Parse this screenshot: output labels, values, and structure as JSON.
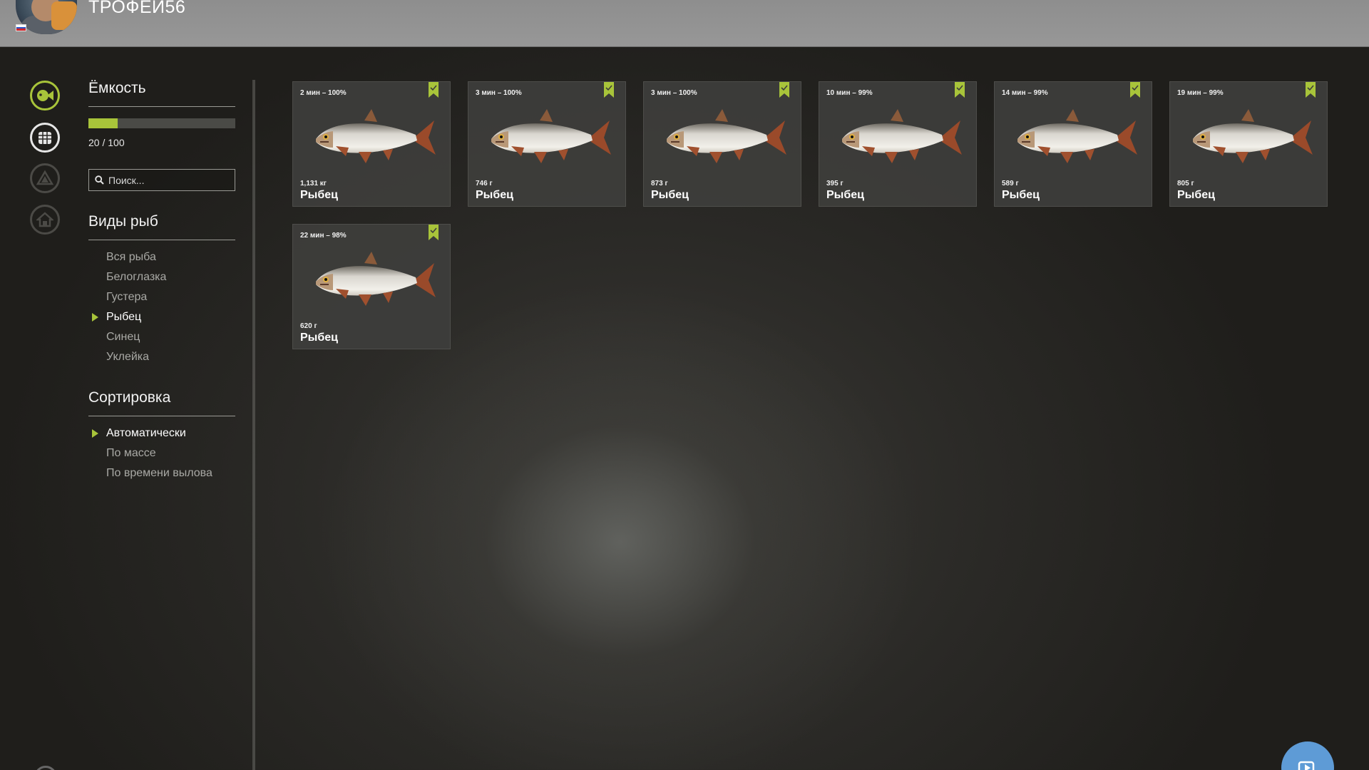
{
  "header": {
    "player_name": "ТРОФЕЙ56",
    "flag": "russia-flag-icon"
  },
  "rail": {
    "icons": [
      "fish-icon",
      "keepnet-icon",
      "tackle-icon",
      "home-icon"
    ]
  },
  "capacity": {
    "title": "Ёмкость",
    "current": 20,
    "max": 100,
    "text": "20 / 100"
  },
  "search": {
    "placeholder": "Поиск..."
  },
  "species": {
    "title": "Виды рыб",
    "items": [
      "Вся рыба",
      "Белоглазка",
      "Густера",
      "Рыбец",
      "Синец",
      "Уклейка"
    ],
    "selected": "Рыбец"
  },
  "sorting": {
    "title": "Сортировка",
    "items": [
      "Автоматически",
      "По массе",
      "По времени вылова"
    ],
    "selected": "Автоматически"
  },
  "fish_cards": [
    {
      "meta": "2 мин – 100%",
      "weight": "1,131 кг",
      "name": "Рыбец"
    },
    {
      "meta": "3 мин – 100%",
      "weight": "746 г",
      "name": "Рыбец"
    },
    {
      "meta": "3 мин – 100%",
      "weight": "873 г",
      "name": "Рыбец"
    },
    {
      "meta": "10 мин – 99%",
      "weight": "395 г",
      "name": "Рыбец"
    },
    {
      "meta": "14 мин – 99%",
      "weight": "589 г",
      "name": "Рыбец"
    },
    {
      "meta": "19 мин – 99%",
      "weight": "805 г",
      "name": "Рыбец"
    },
    {
      "meta": "22 мин – 98%",
      "weight": "620 г",
      "name": "Рыбец"
    }
  ],
  "colors": {
    "accent": "#a8c43a",
    "card_bg": "#3e3e3c",
    "topbar": "#929292",
    "corner_button": "#5e9bd6"
  }
}
